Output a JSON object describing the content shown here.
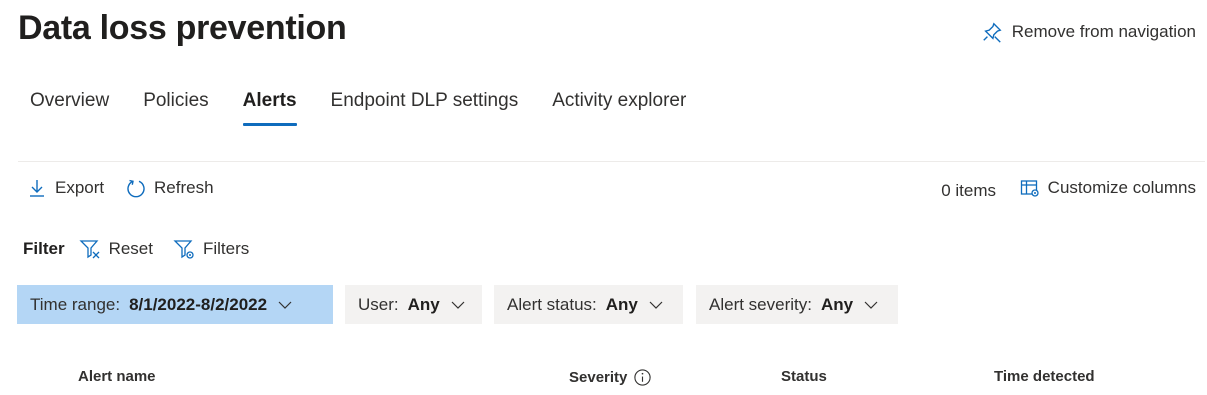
{
  "header": {
    "title": "Data loss prevention",
    "remove_nav_label": "Remove from navigation"
  },
  "tabs": [
    {
      "label": "Overview"
    },
    {
      "label": "Policies"
    },
    {
      "label": "Alerts",
      "active": true
    },
    {
      "label": "Endpoint DLP settings"
    },
    {
      "label": "Activity explorer"
    }
  ],
  "toolbar": {
    "export_label": "Export",
    "refresh_label": "Refresh",
    "items_count": "0 items",
    "customize_label": "Customize columns"
  },
  "filter": {
    "label": "Filter",
    "reset_label": "Reset",
    "filters_label": "Filters",
    "pills": [
      {
        "label": "Time range:",
        "value": "8/1/2022-8/2/2022",
        "selected": true
      },
      {
        "label": "User:",
        "value": "Any"
      },
      {
        "label": "Alert status:",
        "value": "Any"
      },
      {
        "label": "Alert severity:",
        "value": "Any"
      }
    ]
  },
  "table": {
    "columns": [
      "Alert name",
      "Severity",
      "Status",
      "Time detected"
    ]
  },
  "colors": {
    "accent": "#0f6cbd",
    "selected_pill": "#b4d6f5",
    "pill": "#f3f2f1"
  }
}
